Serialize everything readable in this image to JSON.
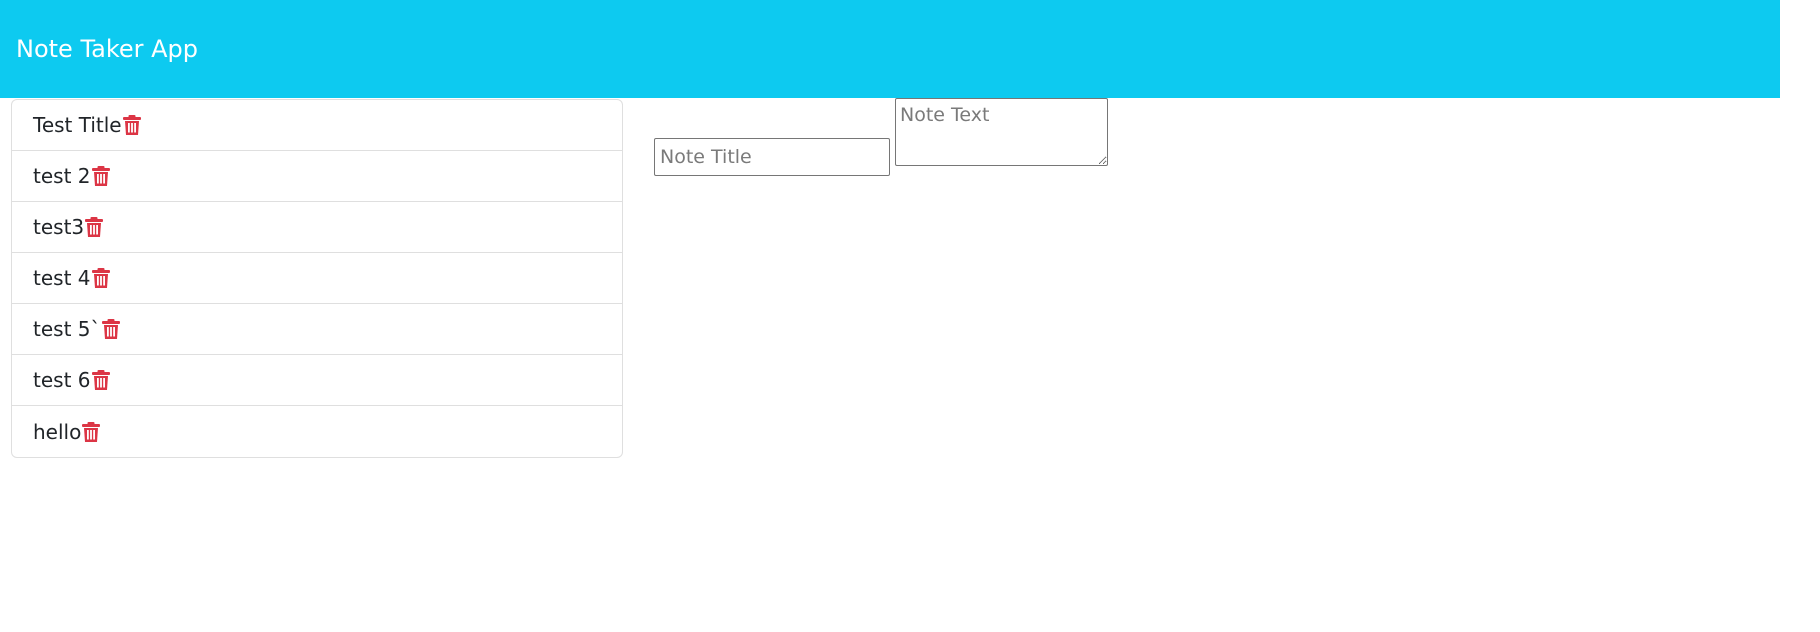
{
  "navbar": {
    "brand": "Note Taker App",
    "background_color": "#0dcaf0"
  },
  "notes": [
    {
      "title": "Test Title",
      "delete_icon": "trash-icon"
    },
    {
      "title": "test 2",
      "delete_icon": "trash-icon"
    },
    {
      "title": "test3",
      "delete_icon": "trash-icon"
    },
    {
      "title": "test 4",
      "delete_icon": "trash-icon"
    },
    {
      "title": "test 5`",
      "delete_icon": "trash-icon"
    },
    {
      "title": "test 6",
      "delete_icon": "trash-icon"
    },
    {
      "title": "hello",
      "delete_icon": "trash-icon"
    }
  ],
  "editor": {
    "title_placeholder": "Note Title",
    "title_value": "",
    "text_placeholder": "Note Text",
    "text_value": ""
  },
  "colors": {
    "delete_icon": "#dc3545"
  }
}
